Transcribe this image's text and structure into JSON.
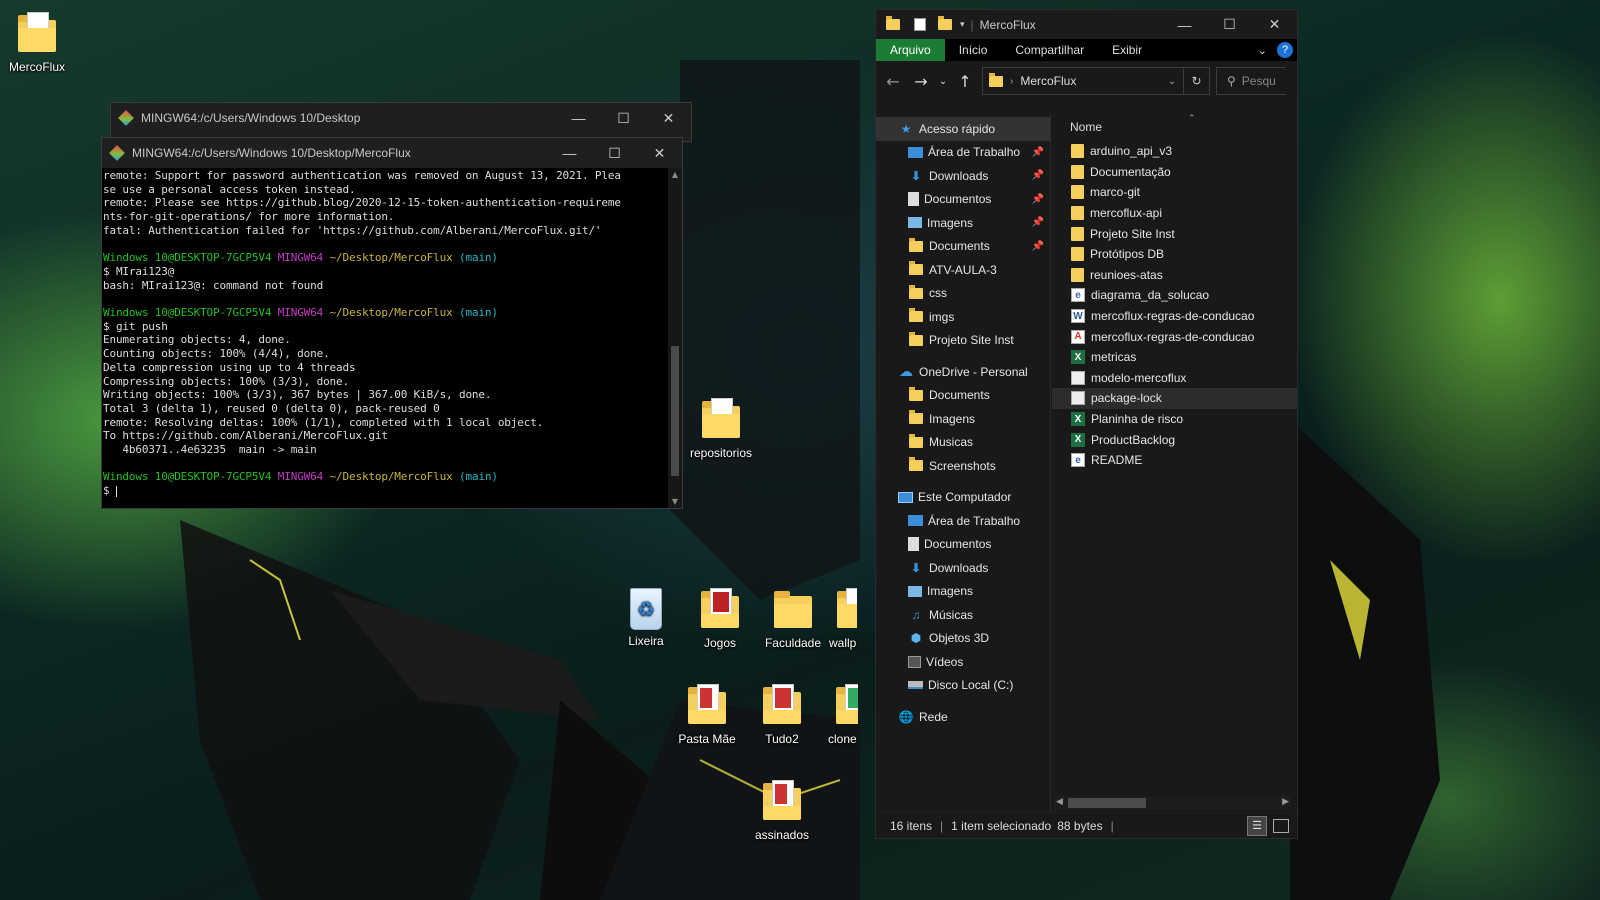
{
  "desktop": {
    "icons": [
      {
        "label": "MercoFlux"
      },
      {
        "label": "repositorios"
      },
      {
        "label": "Lixeira"
      },
      {
        "label": "Jogos"
      },
      {
        "label": "Faculdade"
      },
      {
        "label": "wallp"
      },
      {
        "label": "Pasta Mãe"
      },
      {
        "label": "Tudo2"
      },
      {
        "label": "clone"
      },
      {
        "label": "assinados"
      }
    ]
  },
  "terminal_back": {
    "title": "MINGW64:/c/Users/Windows 10/Desktop"
  },
  "terminal": {
    "title": "MINGW64:/c/Users/Windows 10/Desktop/MercoFlux",
    "prompt_user": "Windows 10@DESKTOP-7GCP5V4",
    "prompt_env": "MINGW64",
    "prompt_path": "~/Desktop/MercoFlux",
    "prompt_branch": "(main)",
    "block1": [
      "remote: Support for password authentication was removed on August 13, 2021. Plea",
      "se use a personal access token instead.",
      "remote: Please see https://github.blog/2020-12-15-token-authentication-requireme",
      "nts-for-git-operations/ for more information.",
      "fatal: Authentication failed for 'https://github.com/Alberani/MercoFlux.git/'"
    ],
    "cmd2": "$ MIrai123@",
    "block2": [
      "bash: MIrai123@: command not found"
    ],
    "cmd3": "$ git push",
    "block3": [
      "Enumerating objects: 4, done.",
      "Counting objects: 100% (4/4), done.",
      "Delta compression using up to 4 threads",
      "Compressing objects: 100% (3/3), done.",
      "Writing objects: 100% (3/3), 367 bytes | 367.00 KiB/s, done.",
      "Total 3 (delta 1), reused 0 (delta 0), pack-reused 0",
      "remote: Resolving deltas: 100% (1/1), completed with 1 local object.",
      "To https://github.com/Alberani/MercoFlux.git",
      "   4b60371..4e63235  main -> main"
    ],
    "cmd4": "$ "
  },
  "explorer": {
    "title": "MercoFlux",
    "ribbon_tabs": [
      "Arquivo",
      "Início",
      "Compartilhar",
      "Exibir"
    ],
    "address": "MercoFlux",
    "search_placeholder": "Pesqu",
    "column_name": "Nome",
    "nav": {
      "quick_access": "Acesso rápido",
      "quick_items": [
        {
          "label": "Área de Trabalho",
          "icon": "desktop-icon",
          "pinned": true
        },
        {
          "label": "Downloads",
          "icon": "download-icon",
          "pinned": true
        },
        {
          "label": "Documentos",
          "icon": "documents-icon",
          "pinned": true
        },
        {
          "label": "Imagens",
          "icon": "pictures-icon",
          "pinned": true
        },
        {
          "label": "Documents",
          "icon": "folder-icon",
          "pinned": true
        },
        {
          "label": "ATV-AULA-3",
          "icon": "folder-icon",
          "pinned": false
        },
        {
          "label": "css",
          "icon": "folder-icon",
          "pinned": false
        },
        {
          "label": "imgs",
          "icon": "folder-icon",
          "pinned": false
        },
        {
          "label": "Projeto Site Inst",
          "icon": "folder-icon",
          "pinned": false
        }
      ],
      "onedrive": "OneDrive - Personal",
      "onedrive_items": [
        "Documents",
        "Imagens",
        "Musicas",
        "Screenshots"
      ],
      "this_pc": "Este Computador",
      "pc_items": [
        {
          "label": "Área de Trabalho",
          "icon": "desktop-icon"
        },
        {
          "label": "Documentos",
          "icon": "documents-icon"
        },
        {
          "label": "Downloads",
          "icon": "download-icon"
        },
        {
          "label": "Imagens",
          "icon": "pictures-icon"
        },
        {
          "label": "Músicas",
          "icon": "music-icon"
        },
        {
          "label": "Objetos 3D",
          "icon": "cube-icon"
        },
        {
          "label": "Vídeos",
          "icon": "video-icon"
        },
        {
          "label": "Disco Local (C:)",
          "icon": "drive-icon"
        }
      ],
      "network": "Rede"
    },
    "files": [
      {
        "name": "arduino_api_v3",
        "type": "folder"
      },
      {
        "name": "Documentação",
        "type": "folder"
      },
      {
        "name": "marco-git",
        "type": "folder"
      },
      {
        "name": "mercoflux-api",
        "type": "folder"
      },
      {
        "name": "Projeto Site Inst",
        "type": "folder"
      },
      {
        "name": "Protótipos DB",
        "type": "folder"
      },
      {
        "name": "reunioes-atas",
        "type": "folder"
      },
      {
        "name": "diagrama_da_solucao",
        "type": "svg"
      },
      {
        "name": "mercoflux-regras-de-conducao",
        "type": "doc"
      },
      {
        "name": "mercoflux-regras-de-conducao",
        "type": "pdf"
      },
      {
        "name": "metricas",
        "type": "xls"
      },
      {
        "name": "modelo-mercoflux",
        "type": "file"
      },
      {
        "name": "package-lock",
        "type": "file",
        "selected": true
      },
      {
        "name": "Planinha  de risco",
        "type": "xls"
      },
      {
        "name": "ProductBacklog",
        "type": "xls"
      },
      {
        "name": "README",
        "type": "svg"
      }
    ],
    "status": {
      "count": "16 itens",
      "selected": "1 item selecionado",
      "size": "88 bytes"
    }
  }
}
